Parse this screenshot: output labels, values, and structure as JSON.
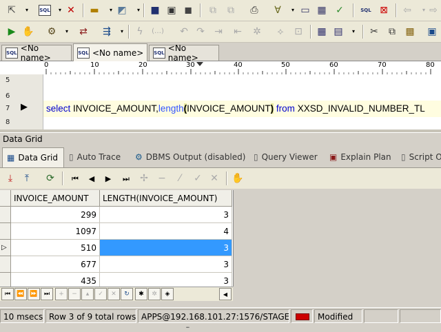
{
  "tabs": [
    {
      "label": "<No name>",
      "badge": "SQL"
    },
    {
      "label": "<No name>",
      "badge": "SQL"
    },
    {
      "label": "<No name>",
      "badge": "SQL"
    }
  ],
  "ruler": {
    "marks": [
      "0",
      "10",
      "20",
      "30",
      "40",
      "50",
      "60",
      "70",
      "80"
    ]
  },
  "editor": {
    "line_numbers": [
      "5",
      "6",
      "7",
      "8"
    ],
    "kw_select": "select",
    "col_name": "INVOICE_AMOUNT",
    "comma": ",",
    "fn_length": "length",
    "paren_open": "(",
    "fn_arg": "INVOICE_AMOUNT",
    "paren_close": ")",
    "kw_from": "from",
    "table_name": "XXSD_INVALID_NUMBER_TL"
  },
  "panel": {
    "title": "Data Grid"
  },
  "result_tabs": [
    {
      "label": "Data Grid"
    },
    {
      "label": "Auto Trace"
    },
    {
      "label": "DBMS Output (disabled)"
    },
    {
      "label": "Query Viewer"
    },
    {
      "label": "Explain Plan"
    },
    {
      "label": "Script Output"
    }
  ],
  "grid": {
    "columns": [
      "INVOICE_AMOUNT",
      "LENGTH(INVOICE_AMOUNT)"
    ],
    "rows": [
      [
        "299",
        "3"
      ],
      [
        "1097",
        "4"
      ],
      [
        "510",
        "3"
      ],
      [
        "677",
        "3"
      ],
      [
        "435",
        "3"
      ]
    ],
    "current_marker": "▷"
  },
  "status": {
    "time": "10 msecs",
    "row_info": "Row 3 of 9 total rows",
    "connection": "APPS@192.168.101.27:1576/STAGE",
    "modified": "Modified"
  },
  "colors": {
    "selection": "#3399ff",
    "keyword": "#0000cc",
    "function": "#3355ff",
    "highlight_line": "#fffde0",
    "modified_indicator": "#cc0000"
  }
}
